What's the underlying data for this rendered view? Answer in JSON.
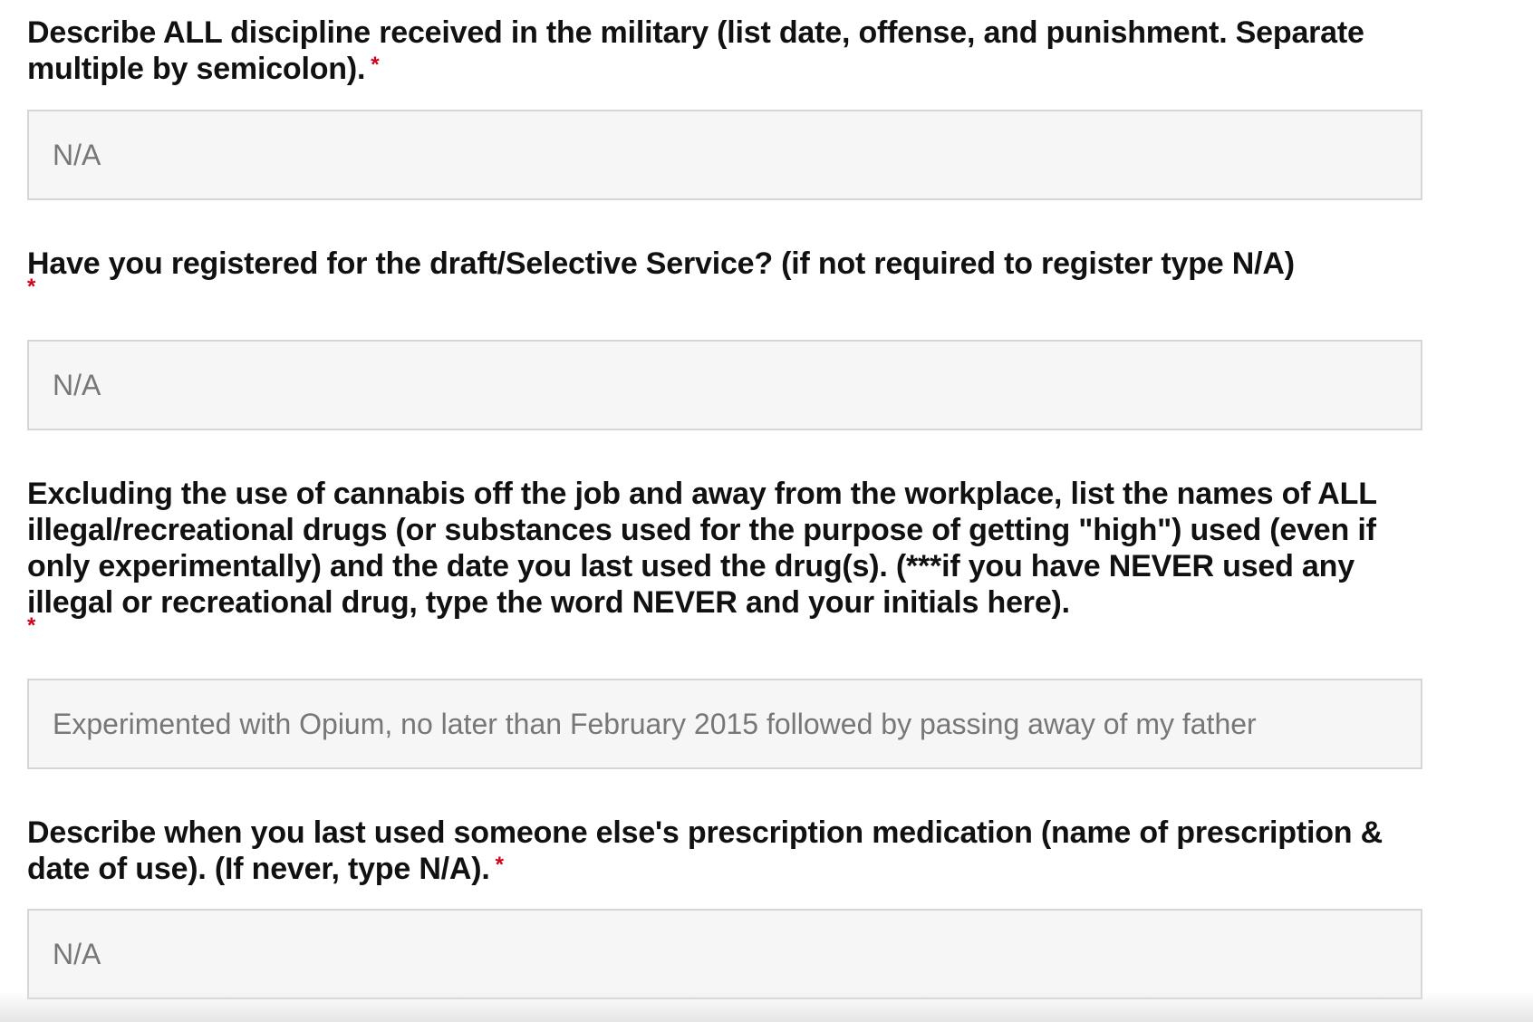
{
  "form": {
    "questions": [
      {
        "label": "Describe ALL discipline received in the military (list date, offense, and punishment. Separate multiple by semicolon).",
        "required_mark": "*",
        "value": "N/A"
      },
      {
        "label": "Have you registered for the draft/Selective Service? (if not required to register type N/A)",
        "required_mark": "*",
        "value": "N/A"
      },
      {
        "label": "Excluding the use of cannabis off the job and away from the workplace, list the names of ALL illegal/recreational drugs (or substances used for the purpose of getting \"high\") used (even if only experimentally) and the date you last used the drug(s). (***if you have NEVER used any illegal or recreational drug, type the word NEVER and your initials here).",
        "required_mark": "*",
        "value": "Experimented with Opium, no later than February 2015 followed by passing away of my father"
      },
      {
        "label": "Describe when you last used someone else's prescription medication (name of prescription & date of use). (If never, type N/A).",
        "required_mark": "*",
        "value": "N/A"
      }
    ]
  }
}
